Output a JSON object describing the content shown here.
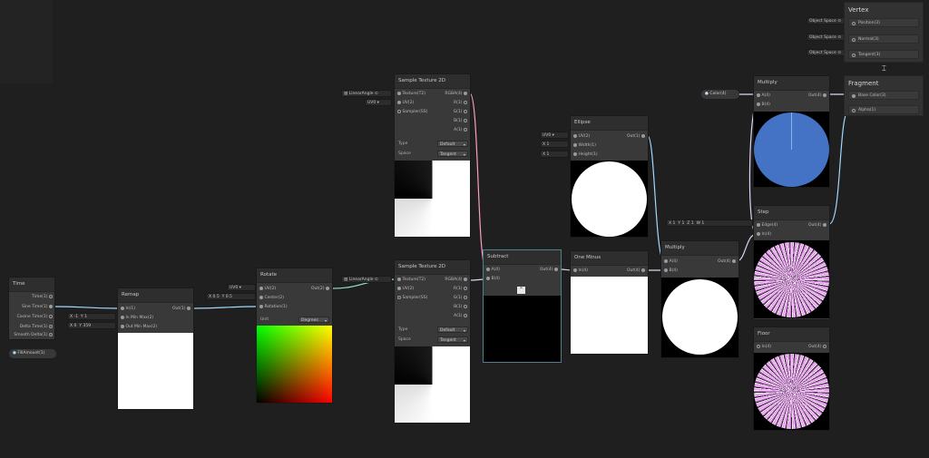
{
  "colors": {
    "canvas": "#1f1f1f",
    "node": "#393939",
    "vector_wire": "#8be9c9",
    "float_wire": "#9fd9ff",
    "color_wire": "#e0d3f5",
    "texture_wire": "#ff9cc8"
  },
  "properties": {
    "fill_amount": "FillAmount(1)",
    "color": "Color(4)"
  },
  "time": {
    "title": "Time",
    "outputs": [
      "Time(1)",
      "Sine Time(1)",
      "Cosine Time(1)",
      "Delta Time(1)",
      "Smooth Delta(1)"
    ]
  },
  "remap": {
    "title": "Remap",
    "in": "In(1)",
    "in_min_max": "In Min Max(2)",
    "out_min_max": "Out Min Max(2)",
    "out": "Out(1)",
    "inmm_x_label": "X",
    "inmm_x": "-1",
    "inmm_y_label": "Y",
    "inmm_y": "1",
    "outmm_x_label": "X",
    "outmm_x": "0",
    "outmm_y_label": "Y",
    "outmm_y": "359"
  },
  "rotate": {
    "title": "Rotate",
    "uv": "UV(2)",
    "center": "Center(2)",
    "rotation": "Rotation(1)",
    "out": "Out(2)",
    "uv_src": "UV0",
    "cx_label": "X",
    "cx": "0.5",
    "cy_label": "Y",
    "cy": "0.5",
    "unit_label": "Unit",
    "unit_value": "Degrees"
  },
  "sample_top": {
    "title": "Sample Texture 2D",
    "texture": "Texture(T2)",
    "uv": "UV(2)",
    "sampler": "Sampler(SS)",
    "outs": [
      "RGBA(4)",
      "R(1)",
      "G(1)",
      "B(1)",
      "A(1)"
    ],
    "type_label": "Type",
    "type_value": "Default",
    "space_label": "Space",
    "space_value": "Tangent",
    "tex_src": "LinearAngle",
    "uv_src": "UV0"
  },
  "sample_bottom": {
    "title": "Sample Texture 2D",
    "texture": "Texture(T2)",
    "uv": "UV(2)",
    "sampler": "Sampler(SS)",
    "outs": [
      "RGBA(4)",
      "R(1)",
      "G(1)",
      "B(1)",
      "A(1)"
    ],
    "type_label": "Type",
    "type_value": "Default",
    "space_label": "Space",
    "space_value": "Tangent",
    "tex_src": "LinearAngle"
  },
  "subtract": {
    "title": "Subtract",
    "a": "A(4)",
    "b": "B(4)",
    "out": "Out(4)",
    "collapse_icon": "chevron-up-icon"
  },
  "ellipse": {
    "title": "Ellipse",
    "uv": "UV(2)",
    "width": "Width(1)",
    "height": "Height(1)",
    "out": "Out(1)",
    "uv_src": "UV0",
    "w_label": "X",
    "w_val": "1",
    "h_label": "X",
    "h_val": "1"
  },
  "one_minus": {
    "title": "One Minus",
    "in": "In(4)",
    "out": "Out(4)"
  },
  "multiply_mid": {
    "title": "Multiply",
    "a": "A(4)",
    "b": "B(4)",
    "out": "Out(4)"
  },
  "multiply_top": {
    "title": "Multiply",
    "a": "A(4)",
    "b": "B(4)",
    "out": "Out(4)"
  },
  "step": {
    "title": "Step",
    "edge": "Edge(4)",
    "in": "In(4)",
    "out": "Out(4)",
    "edge_vals": [
      {
        "l": "X",
        "v": "1"
      },
      {
        "l": "Y",
        "v": "1"
      },
      {
        "l": "Z",
        "v": "1"
      },
      {
        "l": "W",
        "v": "1"
      }
    ]
  },
  "floor": {
    "title": "Floor",
    "in": "In(4)",
    "out": "Out(4)"
  },
  "vertex": {
    "title": "Vertex",
    "rows": [
      {
        "src": "Object Space",
        "port": "Position(3)"
      },
      {
        "src": "Object Space",
        "port": "Normal(3)"
      },
      {
        "src": "Object Space",
        "port": "Tangent(3)"
      }
    ]
  },
  "fragment": {
    "title": "Fragment",
    "rows": [
      "Base Color(3)",
      "Alpha(1)"
    ]
  }
}
